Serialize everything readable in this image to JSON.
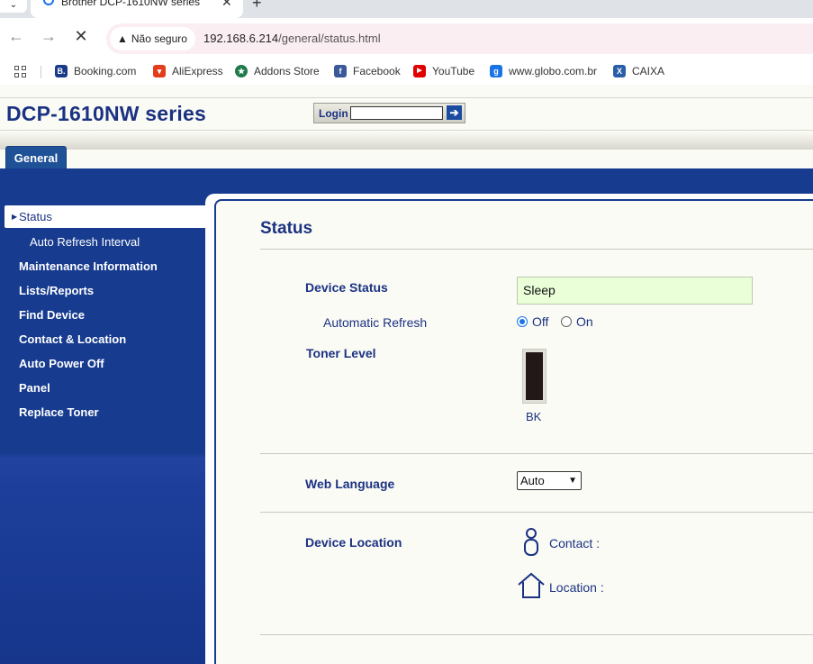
{
  "browser": {
    "tab_title": "Brother DCP-1610NW series",
    "tab_menu": "⌄",
    "close_glyph": "✕",
    "newtab_glyph": "+",
    "security_label": "Não seguro",
    "url_host": "192.168.6.214",
    "url_path": "/general/status.html",
    "bookmarks": [
      {
        "label": "Booking.com",
        "icon": "booking-icon",
        "color": "#1a3b8a",
        "glyph": "B."
      },
      {
        "label": "AliExpress",
        "icon": "aliexpress-icon",
        "color": "#e43d1b",
        "glyph": "▾"
      },
      {
        "label": "Addons Store",
        "icon": "addons-icon",
        "color": "#1e7a4a",
        "glyph": "★"
      },
      {
        "label": "Facebook",
        "icon": "facebook-icon",
        "color": "#3b5998",
        "glyph": "f"
      },
      {
        "label": "YouTube",
        "icon": "youtube-icon",
        "color": "#e00000",
        "glyph": "▶"
      },
      {
        "label": "www.globo.com.br",
        "icon": "globo-icon",
        "color": "#1a73e8",
        "glyph": "g"
      },
      {
        "label": "CAIXA",
        "icon": "caixa-icon",
        "color": "#2a5fa8",
        "glyph": "X"
      }
    ]
  },
  "header": {
    "model": "DCP-1610NW series",
    "login_label": "Login",
    "login_go": "➔"
  },
  "tabs": {
    "general": "General"
  },
  "sidebar": {
    "items": [
      {
        "label": "Status",
        "active": true
      },
      {
        "label": "Auto Refresh Interval"
      },
      {
        "label": "Maintenance Information"
      },
      {
        "label": "Lists/Reports"
      },
      {
        "label": "Find Device"
      },
      {
        "label": "Contact & Location"
      },
      {
        "label": "Auto Power Off"
      },
      {
        "label": "Panel"
      },
      {
        "label": "Replace Toner"
      }
    ]
  },
  "main": {
    "title": "Status",
    "device_status_label": "Device Status",
    "device_status_value": "Sleep",
    "auto_refresh_label": "Automatic Refresh",
    "refresh_off": "Off",
    "refresh_on": "On",
    "refresh_selected": "Off",
    "toner_label": "Toner Level",
    "toner_color_label": "BK",
    "toner_level": 1.0,
    "web_language_label": "Web Language",
    "web_language_value": "Auto",
    "device_location_label": "Device Location",
    "contact_label": "Contact :",
    "location_label": "Location :"
  },
  "colors": {
    "brand_blue": "#1b3282",
    "nav_blue": "#173b8f",
    "status_bg": "#eaffd8"
  }
}
